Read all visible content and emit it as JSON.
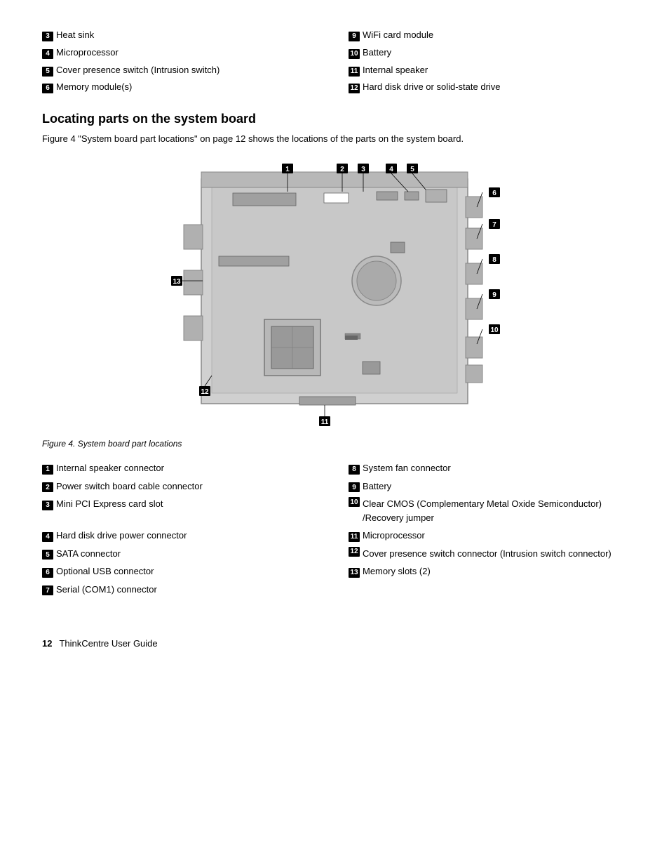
{
  "top_parts": [
    {
      "badge": "3",
      "label": "Heat sink"
    },
    {
      "badge": "9",
      "label": "WiFi card module"
    },
    {
      "badge": "4",
      "label": "Microprocessor"
    },
    {
      "badge": "10",
      "label": "Battery"
    },
    {
      "badge": "5",
      "label": "Cover presence switch (Intrusion switch)"
    },
    {
      "badge": "11",
      "label": "Internal speaker"
    },
    {
      "badge": "6",
      "label": "Memory module(s)"
    },
    {
      "badge": "12",
      "label": "Hard disk drive or solid-state drive"
    }
  ],
  "section_title": "Locating parts on the system board",
  "section_desc": "Figure 4 \"System board part locations\" on page 12 shows the locations of the parts on the system board.",
  "figure_caption": "Figure 4.  System board part locations",
  "callouts": [
    {
      "badge": "1",
      "label": "Internal speaker connector",
      "col": 1
    },
    {
      "badge": "8",
      "label": "System fan connector",
      "col": 2
    },
    {
      "badge": "2",
      "label": "Power switch board cable connector",
      "col": 1
    },
    {
      "badge": "9",
      "label": "Battery",
      "col": 2
    },
    {
      "badge": "3",
      "label": "Mini PCI Express card slot",
      "col": 1
    },
    {
      "badge": "10",
      "label": "Clear CMOS (Complementary Metal Oxide Semiconductor) /Recovery jumper",
      "col": 2,
      "multiline": true
    },
    {
      "badge": "4",
      "label": "Hard disk drive power connector",
      "col": 1
    },
    {
      "badge": "11",
      "label": "Microprocessor",
      "col": 2
    },
    {
      "badge": "5",
      "label": "SATA connector",
      "col": 1
    },
    {
      "badge": "12",
      "label": "Cover presence switch connector (Intrusion switch connector)",
      "col": 2,
      "multiline": true
    },
    {
      "badge": "6",
      "label": "Optional USB connector",
      "col": 1
    },
    {
      "badge": "13",
      "label": "Memory slots (2)",
      "col": 2
    },
    {
      "badge": "7",
      "label": "Serial (COM1) connector",
      "col": 1
    }
  ],
  "footer": {
    "page": "12",
    "title": "ThinkCentre User Guide"
  }
}
